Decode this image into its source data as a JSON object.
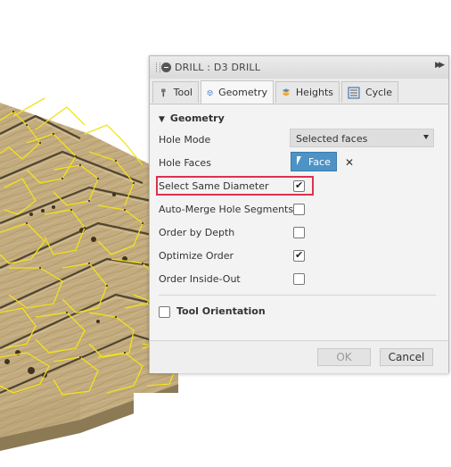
{
  "dialog": {
    "title": "DRILL : D3 DRILL",
    "tabs": [
      {
        "label": "Tool",
        "icon": "tool-icon"
      },
      {
        "label": "Geometry",
        "icon": "geometry-cube-icon",
        "active": true
      },
      {
        "label": "Heights",
        "icon": "heights-icon"
      },
      {
        "label": "Cycle",
        "icon": "cycle-icon"
      }
    ],
    "section_title": "Geometry",
    "hole_mode": {
      "label": "Hole Mode",
      "value": "Selected faces"
    },
    "hole_faces": {
      "label": "Hole Faces",
      "button": "Face"
    },
    "options": [
      {
        "label": "Select Same Diameter",
        "checked": true
      },
      {
        "label": "Auto-Merge Hole Segments",
        "checked": false
      },
      {
        "label": "Order by Depth",
        "checked": false
      },
      {
        "label": "Optimize Order",
        "checked": true
      },
      {
        "label": "Order Inside-Out",
        "checked": false
      }
    ],
    "tool_orientation": "Tool Orientation",
    "ok": "OK",
    "cancel": "Cancel"
  },
  "colors": {
    "accent": "#4e93c5",
    "highlight": "#e0304e",
    "toolpath": "#f2e21b",
    "wood": "#c7b286"
  }
}
